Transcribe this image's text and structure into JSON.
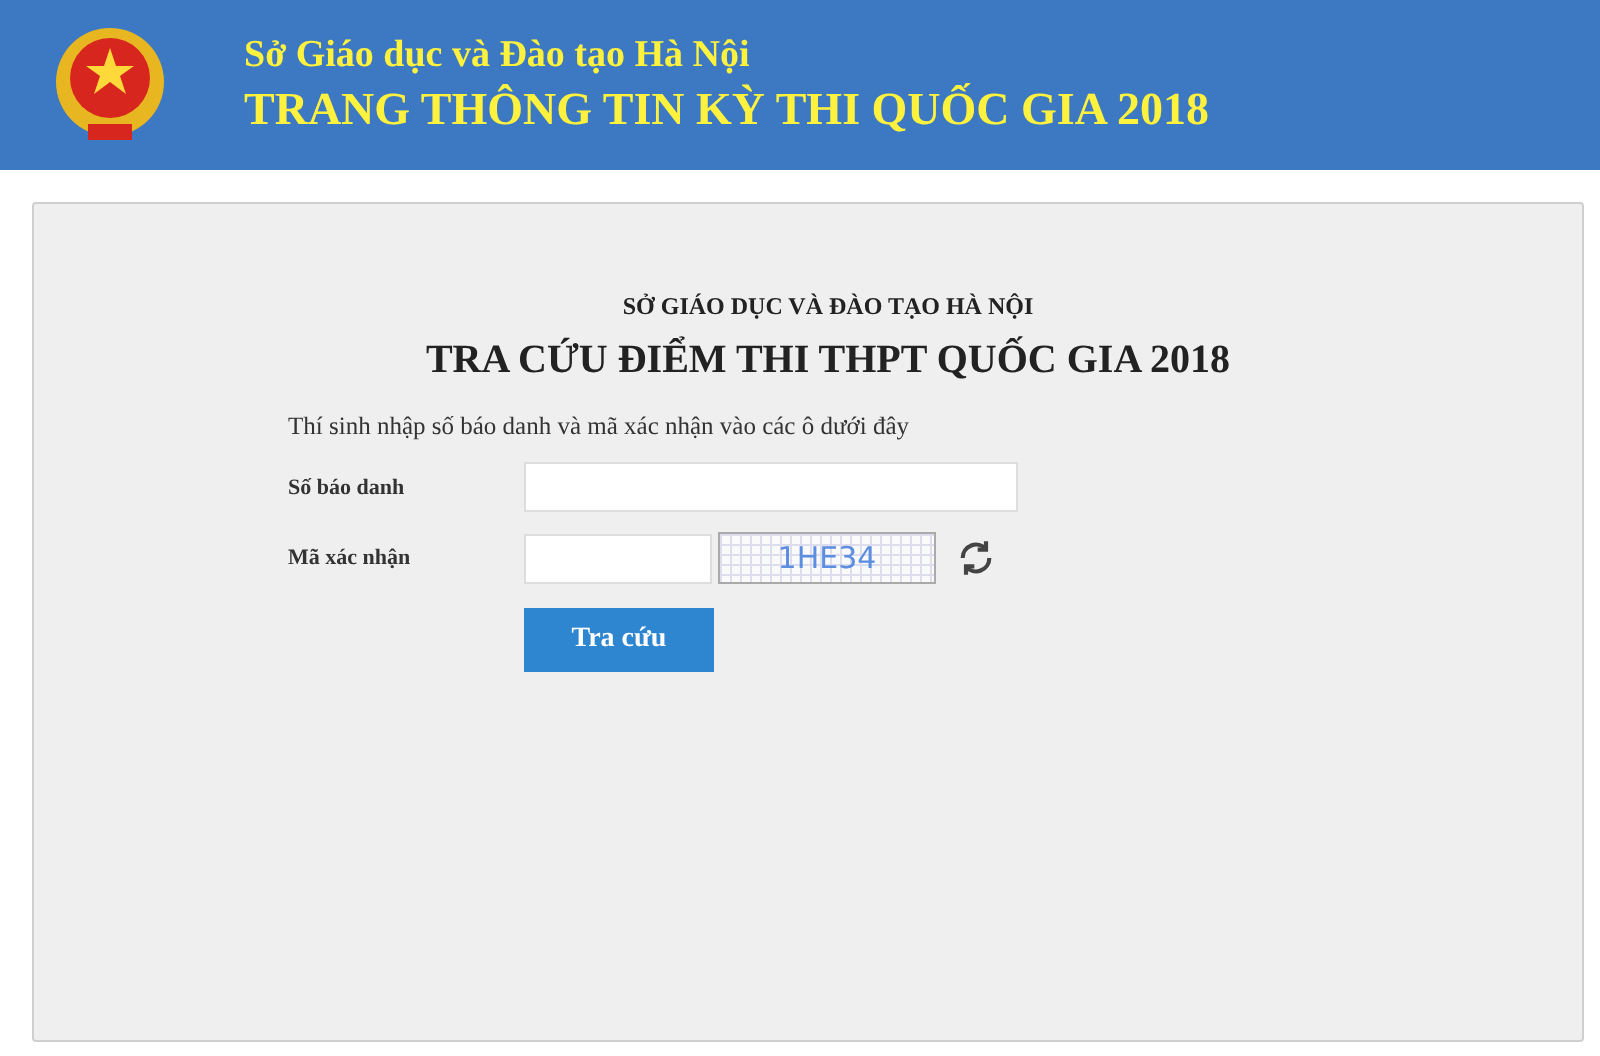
{
  "header": {
    "subtitle": "Sở Giáo dục và Đào tạo Hà Nội",
    "title": "TRANG THÔNG TIN KỲ THI QUỐC GIA 2018"
  },
  "form": {
    "organization": "SỞ GIÁO DỤC VÀ ĐÀO TẠO HÀ NỘI",
    "title": "TRA CỨU ĐIỂM THI THPT QUỐC GIA 2018",
    "instruction": "Thí sinh nhập số báo danh và mã xác nhận vào các ô dưới đây",
    "fields": [
      {
        "kind": "text",
        "label": "Số báo danh"
      },
      {
        "kind": "captcha",
        "label": "Mã xác nhận",
        "captcha": "1HE34"
      }
    ],
    "submit": "Tra cứu"
  }
}
